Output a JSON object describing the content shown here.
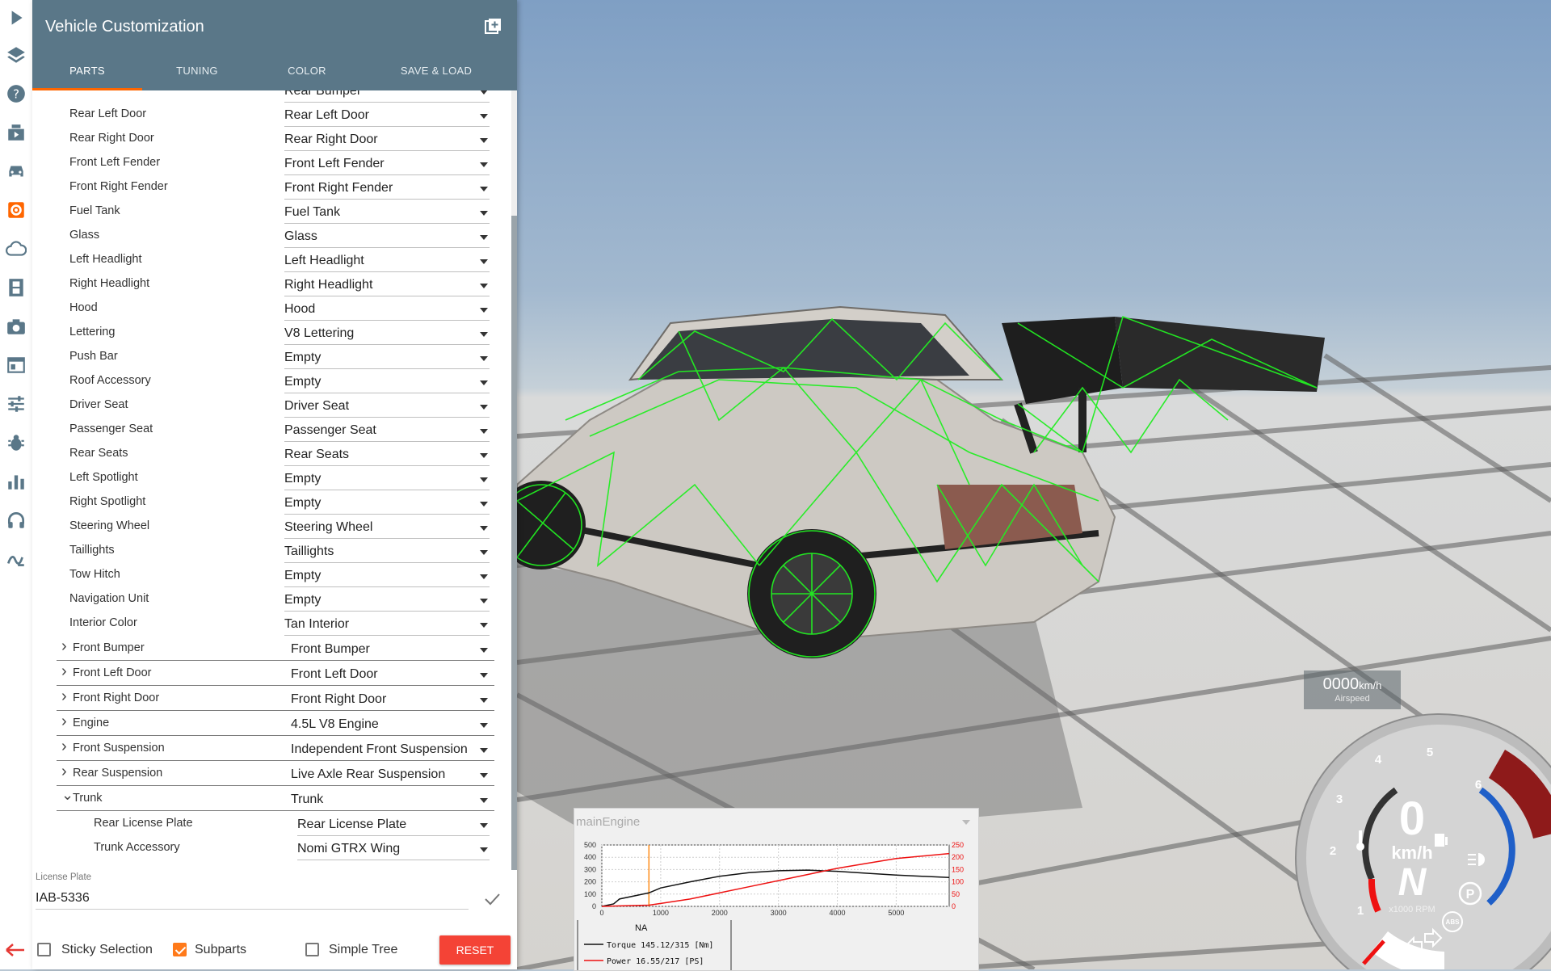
{
  "panel": {
    "title": "Vehicle Customization",
    "tabs": [
      {
        "label": "PARTS",
        "active": true
      },
      {
        "label": "TUNING",
        "active": false
      },
      {
        "label": "COLOR",
        "active": false
      },
      {
        "label": "SAVE & LOAD",
        "active": false
      }
    ],
    "cut_top_value": "Rear Bumper"
  },
  "parts": [
    {
      "label": "Rear Left Door",
      "value": "Rear Left Door"
    },
    {
      "label": "Rear Right Door",
      "value": "Rear Right Door"
    },
    {
      "label": "Front Left Fender",
      "value": "Front Left Fender"
    },
    {
      "label": "Front Right Fender",
      "value": "Front Right Fender"
    },
    {
      "label": "Fuel Tank",
      "value": "Fuel Tank"
    },
    {
      "label": "Glass",
      "value": "Glass"
    },
    {
      "label": "Left Headlight",
      "value": "Left Headlight"
    },
    {
      "label": "Right Headlight",
      "value": "Right Headlight"
    },
    {
      "label": "Hood",
      "value": "Hood"
    },
    {
      "label": "Lettering",
      "value": "V8 Lettering"
    },
    {
      "label": "Push Bar",
      "value": "Empty"
    },
    {
      "label": "Roof Accessory",
      "value": "Empty"
    },
    {
      "label": "Driver Seat",
      "value": "Driver Seat"
    },
    {
      "label": "Passenger Seat",
      "value": "Passenger Seat"
    },
    {
      "label": "Rear Seats",
      "value": "Rear Seats"
    },
    {
      "label": "Left Spotlight",
      "value": "Empty"
    },
    {
      "label": "Right Spotlight",
      "value": "Empty"
    },
    {
      "label": "Steering Wheel",
      "value": "Steering Wheel"
    },
    {
      "label": "Taillights",
      "value": "Taillights"
    },
    {
      "label": "Tow Hitch",
      "value": "Empty"
    },
    {
      "label": "Navigation Unit",
      "value": "Empty"
    },
    {
      "label": "Interior Color",
      "value": "Tan Interior"
    }
  ],
  "groups": [
    {
      "label": "Front Bumper",
      "value": "Front Bumper",
      "expanded": false
    },
    {
      "label": "Front Left Door",
      "value": "Front Left Door",
      "expanded": false
    },
    {
      "label": "Front Right Door",
      "value": "Front Right Door",
      "expanded": false
    },
    {
      "label": "Engine",
      "value": "4.5L V8 Engine",
      "expanded": false
    },
    {
      "label": "Front Suspension",
      "value": "Independent Front Suspension",
      "expanded": false
    },
    {
      "label": "Rear Suspension",
      "value": "Live Axle Rear Suspension",
      "expanded": false
    },
    {
      "label": "Trunk",
      "value": "Trunk",
      "expanded": true
    }
  ],
  "subparts": [
    {
      "label": "Rear License Plate",
      "value": "Rear License Plate"
    },
    {
      "label": "Trunk Accessory",
      "value": "Nomi GTRX Wing"
    }
  ],
  "license_plate": {
    "label": "License Plate",
    "value": "IAB-5336"
  },
  "options": {
    "sticky_selection": {
      "label": "Sticky Selection",
      "checked": false
    },
    "subparts": {
      "label": "Subparts",
      "checked": true
    },
    "simple_tree": {
      "label": "Simple Tree",
      "checked": false
    },
    "reset_label": "RESET"
  },
  "toolbar_icons": [
    "play-icon",
    "layers-icon",
    "help-icon",
    "clapper-icon",
    "car-icon",
    "gear-icon",
    "cloud-icon",
    "film-icon",
    "camera-icon",
    "window-icon",
    "sliders-icon",
    "bug-icon",
    "bar-chart-icon",
    "headphones-icon",
    "wave-icon",
    "exit-arrow-icon"
  ],
  "engine_graph": {
    "title": "mainEngine",
    "mode": "NA",
    "torque_text": "Torque 145.12/315 [Nm]",
    "power_text": "Power 16.55/217  [PS]",
    "x_ticks": [
      "0",
      "1000",
      "2000",
      "3000",
      "4000",
      "5000"
    ],
    "y_left_ticks": [
      "0",
      "100",
      "200",
      "300",
      "400",
      "500"
    ],
    "y_right_ticks": [
      "0",
      "50",
      "100",
      "150",
      "200",
      "250"
    ],
    "rpm_marker": 800,
    "torque_curve": [
      [
        0,
        0
      ],
      [
        200,
        20
      ],
      [
        300,
        60
      ],
      [
        800,
        110
      ],
      [
        1000,
        150
      ],
      [
        1500,
        200
      ],
      [
        2000,
        245
      ],
      [
        2500,
        275
      ],
      [
        3000,
        290
      ],
      [
        3500,
        295
      ],
      [
        4000,
        285
      ],
      [
        4500,
        270
      ],
      [
        5000,
        255
      ],
      [
        5900,
        235
      ]
    ],
    "power_curve": [
      [
        0,
        0
      ],
      [
        800,
        5
      ],
      [
        1000,
        12
      ],
      [
        1500,
        30
      ],
      [
        2000,
        55
      ],
      [
        2500,
        80
      ],
      [
        3000,
        105
      ],
      [
        3500,
        130
      ],
      [
        4000,
        155
      ],
      [
        4500,
        175
      ],
      [
        5000,
        195
      ],
      [
        5900,
        215
      ]
    ]
  },
  "hud": {
    "airspeed_value": "0000",
    "airspeed_unit": "km/h",
    "airspeed_label": "Airspeed",
    "speed": "0",
    "speed_unit": "km/h",
    "gear": "N",
    "rpm_label": "x1000 RPM",
    "rpm_ticks": [
      "1",
      "2",
      "3",
      "4",
      "5",
      "6"
    ],
    "gear_p": "P",
    "abs": "ABS",
    "colors": {
      "accent": "#ff6600",
      "header": "#5a7788",
      "wireframe": "#22ee22",
      "reset": "#f44336"
    }
  }
}
